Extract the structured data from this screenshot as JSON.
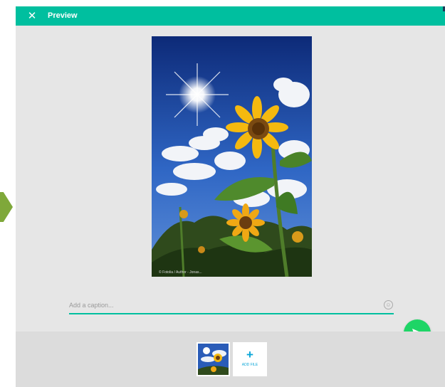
{
  "window": {
    "title": "Preview"
  },
  "icons": {
    "close": "close-icon",
    "emoji": "emoji-icon",
    "send": "send-icon",
    "add": "plus-icon"
  },
  "preview": {
    "image_alt": "sunflower against blue sky",
    "credit": "© Fotolia / Author - Jonas..."
  },
  "caption": {
    "placeholder": "Add a caption...",
    "value": ""
  },
  "tray": {
    "add_file_label": "ADD FILE"
  },
  "colors": {
    "accent": "#00bf9f",
    "send": "#1ed566",
    "background": "#e6e6e6",
    "tray": "#dcdcdc",
    "add_file": "#0aa6d8"
  }
}
